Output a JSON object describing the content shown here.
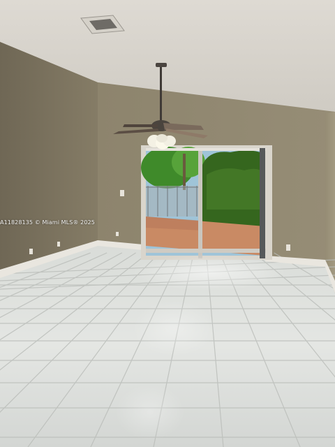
{
  "photo": {
    "watermark": "A11828135 © Miami MLS® 2025"
  }
}
